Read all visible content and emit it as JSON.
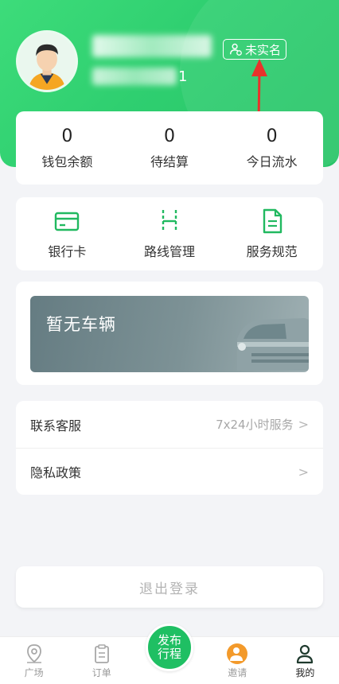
{
  "profile": {
    "phone_tail": "1",
    "verify_badge": "未实名"
  },
  "stats": [
    {
      "value": "0",
      "label": "钱包余额"
    },
    {
      "value": "0",
      "label": "待结算"
    },
    {
      "value": "0",
      "label": "今日流水"
    }
  ],
  "tools": [
    {
      "label": "银行卡",
      "icon": "bank-card-icon"
    },
    {
      "label": "路线管理",
      "icon": "route-icon"
    },
    {
      "label": "服务规范",
      "icon": "document-icon"
    }
  ],
  "vehicle": {
    "empty_text": "暂无车辆"
  },
  "menu": {
    "service_label": "联系客服",
    "service_value": "7x24小时服务",
    "privacy_label": "隐私政策"
  },
  "logout_label": "退出登录",
  "tabbar": {
    "square": "广场",
    "orders": "订单",
    "publish_line1": "发布",
    "publish_line2": "行程",
    "invite": "邀请",
    "mine": "我的"
  },
  "colors": {
    "brand_green": "#2fcf70",
    "accent_orange": "#f39a2b"
  }
}
